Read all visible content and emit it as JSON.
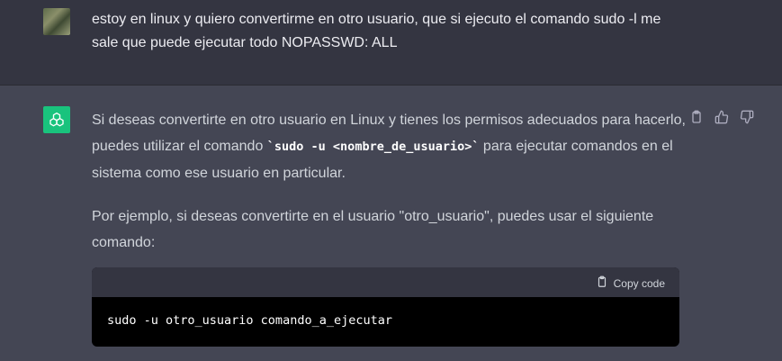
{
  "user_message": {
    "text": "estoy en linux y quiero convertirme en otro usuario, que si ejecuto el comando sudo -l me sale que puede ejecutar todo NOPASSWD: ALL"
  },
  "assistant_message": {
    "p1_a": "Si deseas convertirte en otro usuario en Linux y tienes los permisos adecuados para hacerlo, puedes utilizar el comando ",
    "p1_code": "`sudo -u <nombre_de_usuario>`",
    "p1_b": " para ejecutar comandos en el sistema como ese usuario en particular.",
    "p2": "Por ejemplo, si deseas convertirte en el usuario \"otro_usuario\", puedes usar el siguiente comando:",
    "code_block": {
      "copy_label": "Copy code",
      "code": "sudo -u otro_usuario comando_a_ejecutar"
    }
  },
  "icons": {
    "copy": "clipboard-icon",
    "thumbs_up": "thumbs-up-icon",
    "thumbs_down": "thumbs-down-icon",
    "assistant": "openai-logo-icon"
  },
  "colors": {
    "user_bg": "#343541",
    "assistant_bg": "#444654",
    "avatar_green": "#19c37d",
    "code_bg": "#000000"
  }
}
